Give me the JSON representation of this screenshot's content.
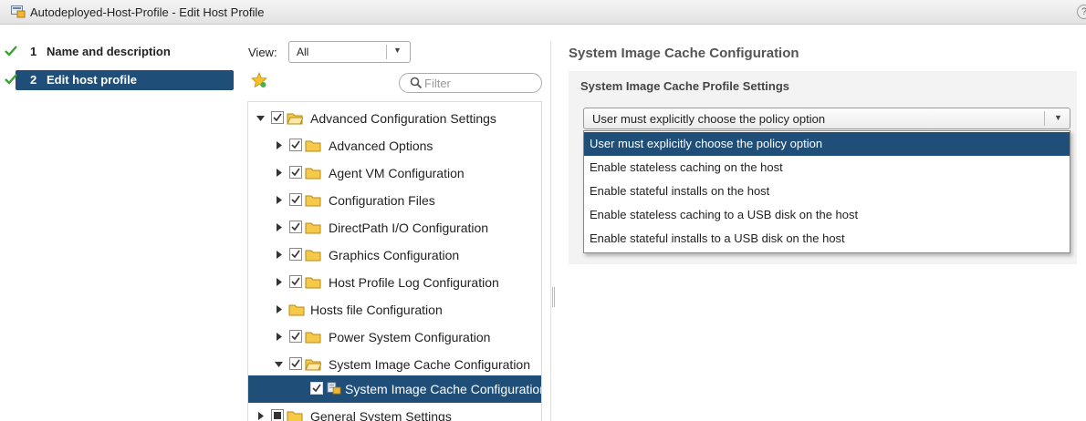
{
  "window": {
    "title": "Autodeployed-Host-Profile - Edit Host Profile",
    "help_label": "?"
  },
  "steps": [
    {
      "number": "1",
      "label": "Name and description",
      "completed": true,
      "active": false
    },
    {
      "number": "2",
      "label": "Edit host profile",
      "completed": true,
      "active": true
    }
  ],
  "view": {
    "label": "View:",
    "selected": "All"
  },
  "filter": {
    "placeholder": "Filter"
  },
  "tree": [
    {
      "label": "Advanced Configuration Settings",
      "level": 0,
      "expanded": true,
      "checked": true
    },
    {
      "label": "Advanced Options",
      "level": 1,
      "expanded": false,
      "checked": true
    },
    {
      "label": "Agent VM Configuration",
      "level": 1,
      "expanded": false,
      "checked": true
    },
    {
      "label": "Configuration Files",
      "level": 1,
      "expanded": false,
      "checked": true
    },
    {
      "label": "DirectPath I/O Configuration",
      "level": 1,
      "expanded": false,
      "checked": true
    },
    {
      "label": "Graphics Configuration",
      "level": 1,
      "expanded": false,
      "checked": true
    },
    {
      "label": "Host Profile Log Configuration",
      "level": 1,
      "expanded": false,
      "checked": true
    },
    {
      "label": "Hosts file Configuration",
      "level": 1,
      "expanded": false,
      "checked": null
    },
    {
      "label": "Power System Configuration",
      "level": 1,
      "expanded": false,
      "checked": true
    },
    {
      "label": "System Image Cache Configuration",
      "level": 1,
      "expanded": true,
      "checked": true
    },
    {
      "label": "System Image Cache Configuration",
      "level": 2,
      "expanded": null,
      "checked": true,
      "selected": true
    },
    {
      "label": "General System Settings",
      "level": 0,
      "expanded": false,
      "checked": "partial"
    }
  ],
  "detail": {
    "title": "System Image Cache Configuration",
    "settings_title": "System Image Cache Profile Settings",
    "policy_selected": "User must explicitly choose the policy option",
    "policy_options": [
      "User must explicitly choose the policy option",
      "Enable stateless caching on the host",
      "Enable stateful installs on the host",
      "Enable stateless caching to a USB disk on the host",
      "Enable stateful installs to a USB disk on the host"
    ]
  },
  "colors": {
    "selection": "#1f4e79",
    "check_green": "#3aa332",
    "folder": "#f7c948"
  }
}
